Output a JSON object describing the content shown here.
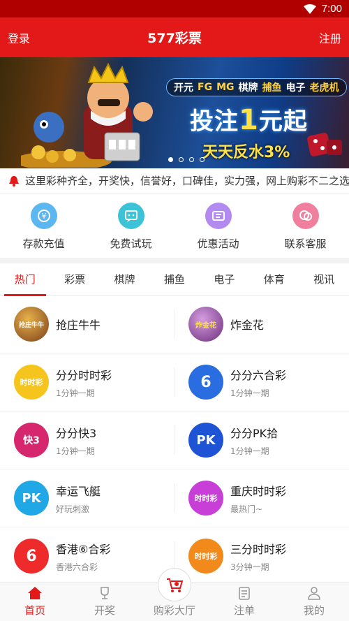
{
  "status_bar": {
    "time": "7:00"
  },
  "header": {
    "login": "登录",
    "title": "577彩票",
    "register": "注册"
  },
  "banner": {
    "tags": [
      "开元",
      "FG",
      "MG",
      "棋牌",
      "捕鱼",
      "电子",
      "老虎机"
    ],
    "headline_prefix": "投注",
    "headline_number": "1",
    "headline_suffix": "元起",
    "subline": "天天反水3%"
  },
  "notice": {
    "text": "这里彩种齐全，开奖快，信誉好，口碑佳，实力强，网上购彩不二之选"
  },
  "quick_actions": [
    {
      "label": "存款充值",
      "icon": "deposit-icon",
      "color": "#5cb6f0"
    },
    {
      "label": "免费试玩",
      "icon": "chat-icon",
      "color": "#3cc3d8"
    },
    {
      "label": "优惠活动",
      "icon": "ticket-icon",
      "color": "#b28af0"
    },
    {
      "label": "联系客服",
      "icon": "service-icon",
      "color": "#f07f9e"
    }
  ],
  "tabs": [
    "热门",
    "彩票",
    "棋牌",
    "捕鱼",
    "电子",
    "体育",
    "视讯"
  ],
  "games": [
    [
      {
        "name": "抢庄牛牛",
        "sub": "",
        "color": "#7a3e1a"
      },
      {
        "name": "炸金花",
        "sub": "",
        "color": "#6b2f7a"
      }
    ],
    [
      {
        "name": "分分时时彩",
        "sub": "1分钟一期",
        "color": "#f6c51d"
      },
      {
        "name": "分分六合彩",
        "sub": "1分钟一期",
        "color": "#2a6de0"
      }
    ],
    [
      {
        "name": "分分快3",
        "sub": "1分钟一期",
        "color": "#d6266d"
      },
      {
        "name": "分分PK拾",
        "sub": "1分钟一期",
        "color": "#1e53d6"
      }
    ],
    [
      {
        "name": "幸运飞艇",
        "sub": "好玩刺激",
        "color": "#1fa7e6"
      },
      {
        "name": "重庆时时彩",
        "sub": "最热门~",
        "color": "#c73fd6"
      }
    ],
    [
      {
        "name": "香港⑥合彩",
        "sub": "香港六合彩",
        "color": "#ef2a2a"
      },
      {
        "name": "三分时时彩",
        "sub": "3分钟一期",
        "color": "#f28a1b"
      }
    ]
  ],
  "game_icon_texts": [
    [
      "抢庄牛牛",
      "炸金花"
    ],
    [
      "时时彩",
      "6"
    ],
    [
      "快3",
      "PK"
    ],
    [
      "PK",
      "时时彩"
    ],
    [
      "6",
      "时时彩"
    ]
  ],
  "bottom_nav": [
    {
      "label": "首页",
      "icon": "home-icon",
      "active": true
    },
    {
      "label": "开奖",
      "icon": "trophy-icon",
      "active": false
    },
    {
      "label": "购彩大厅",
      "icon": "cart-icon",
      "active": false
    },
    {
      "label": "注单",
      "icon": "clipboard-icon",
      "active": false
    },
    {
      "label": "我的",
      "icon": "user-icon",
      "active": false
    }
  ],
  "colors": {
    "primary": "#e21918",
    "status_bar": "#b00000"
  }
}
